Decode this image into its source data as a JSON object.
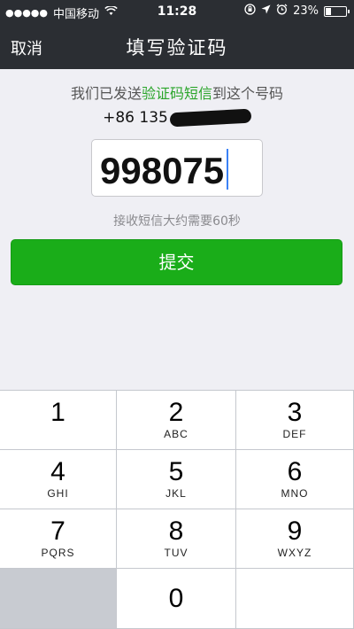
{
  "status_bar": {
    "signal_dots": "●●●●●",
    "carrier": "中国移动",
    "time": "11:28",
    "battery_percent": "23%",
    "battery_level": 0.23,
    "icons": [
      "signal-dots-icon",
      "wifi-icon",
      "rotation-lock-icon",
      "location-arrow-icon",
      "alarm-clock-icon",
      "battery-icon"
    ]
  },
  "nav": {
    "cancel_label": "取消",
    "title": "填写验证码"
  },
  "content": {
    "sent_prefix": "我们已发送",
    "sent_highlight": "验证码短信",
    "sent_suffix": "到这个号码",
    "phone_visible": "+86 135",
    "code_value": "998075",
    "hint": "接收短信大约需要60秒",
    "submit_label": "提交",
    "highlight_color": "#2aa52a",
    "submit_color": "#1aad19"
  },
  "keypad": {
    "keys": [
      {
        "num": "1",
        "letters": ""
      },
      {
        "num": "2",
        "letters": "ABC"
      },
      {
        "num": "3",
        "letters": "DEF"
      },
      {
        "num": "4",
        "letters": "GHI"
      },
      {
        "num": "5",
        "letters": "JKL"
      },
      {
        "num": "6",
        "letters": "MNO"
      },
      {
        "num": "7",
        "letters": "PQRS"
      },
      {
        "num": "8",
        "letters": "TUV"
      },
      {
        "num": "9",
        "letters": "WXYZ"
      },
      {
        "num": "0",
        "letters": ""
      }
    ]
  },
  "watermark": {
    "text_red": "",
    "text_blue": ""
  }
}
